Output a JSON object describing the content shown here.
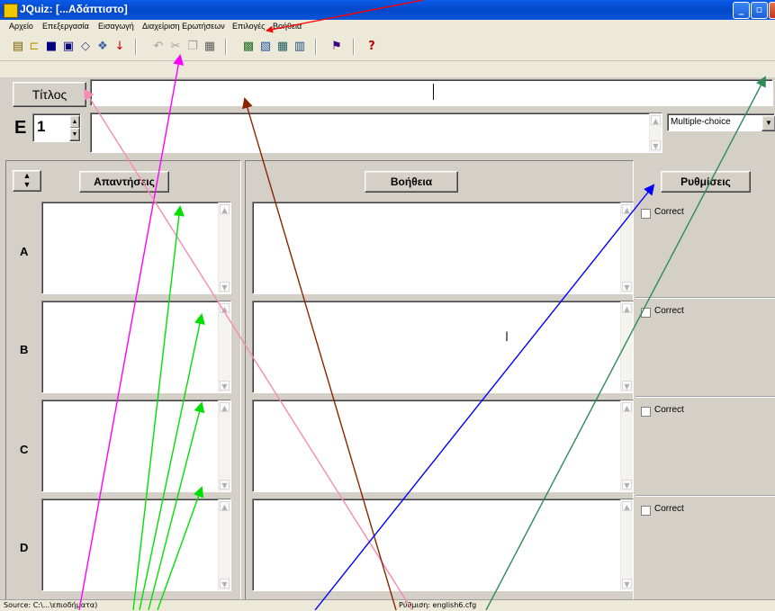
{
  "window": {
    "title": "JQuiz: [...Αδάπτιστο]"
  },
  "menu": [
    "Αρχείο",
    "Επεξεργασία",
    "Εισαγωγή",
    "Διαχείριση Ερωτήσεων",
    "Επιλογές",
    "Βοήθεια"
  ],
  "toolbar": {
    "icons": [
      "new-icon",
      "open-icon",
      "save-icon",
      "save-as-icon",
      "eraser-icon",
      "web-export-icon",
      "arrow-down-icon",
      "undo-icon",
      "cut-icon",
      "copy-icon",
      "paste-icon",
      "wizard1-icon",
      "wizard2-icon",
      "wizard3-icon",
      "wizard4-icon",
      "flag-icon",
      "help-icon"
    ]
  },
  "title_button": "Τίτλος",
  "title_value": "",
  "question": {
    "label": "E",
    "number": "1",
    "type_selected": "Multiple-choice"
  },
  "headers": {
    "answers": "Απαντήσεις",
    "help": "Βοήθεια",
    "settings": "Ρυθμίσεις"
  },
  "rows": [
    {
      "letter": "A",
      "answer": "",
      "feedback": "",
      "correct_label": "Correct"
    },
    {
      "letter": "B",
      "answer": "",
      "feedback": "",
      "correct_label": "Correct"
    },
    {
      "letter": "C",
      "answer": "",
      "feedback": "",
      "correct_label": "Correct"
    },
    {
      "letter": "D",
      "answer": "",
      "feedback": "",
      "correct_label": "Correct"
    }
  ],
  "status": {
    "source": "Source: C:\\...\\επιοδήματα)",
    "settings_file": "Ρύθμιση: english6.cfg"
  },
  "annotation_colors": {
    "red": "#ff0000",
    "magenta": "#ff00ff",
    "pink": "#f48cb4",
    "brown": "#8b2500",
    "green": "#00e000",
    "blue": "#0000ff",
    "teal": "#2e8b57"
  },
  "annotation_arrow_count": 12
}
